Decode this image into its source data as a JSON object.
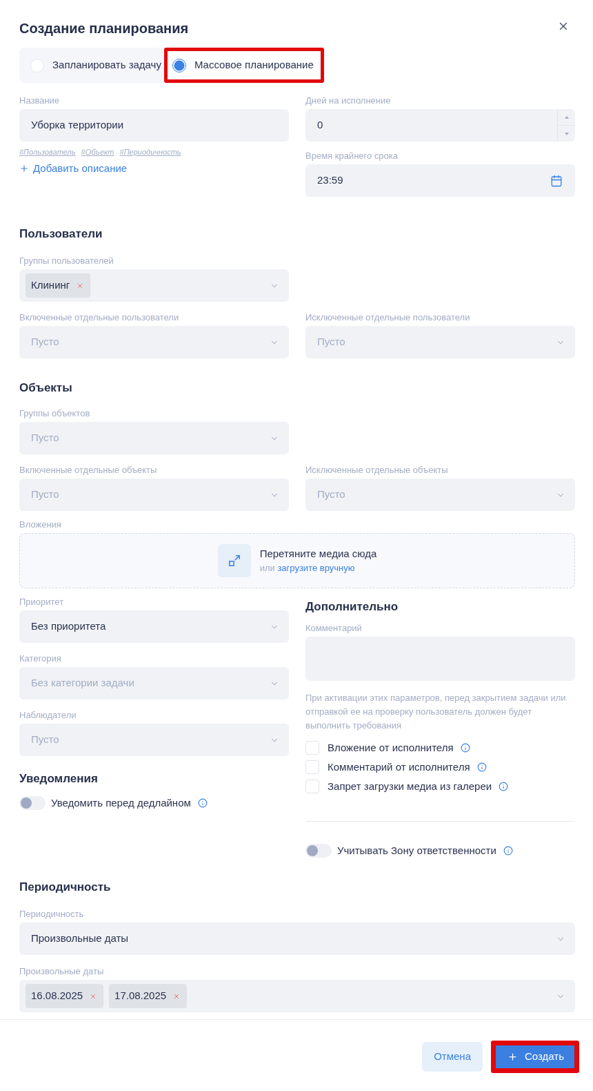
{
  "dialog": {
    "title": "Создание планирования"
  },
  "mode_options": [
    {
      "label": "Запланировать задачу",
      "selected": false,
      "highlighted": false
    },
    {
      "label": "Массовое планирование",
      "selected": true,
      "highlighted": true
    }
  ],
  "general": {
    "name": {
      "label": "Название",
      "value": "Уборка территории"
    },
    "tags": [
      "#Пользователь",
      "#Объект",
      "#Периодичность"
    ],
    "add_description": "Добавить описание",
    "days": {
      "label": "Дней на исполнение",
      "value": "0"
    },
    "deadline_time": {
      "label": "Время крайнего срока",
      "value": "23:59"
    }
  },
  "users": {
    "title": "Пользователи",
    "groups": {
      "label": "Группы пользователей",
      "chips": [
        "Клининг"
      ]
    },
    "included": {
      "label": "Включенные отдельные пользователи",
      "placeholder": "Пусто"
    },
    "excluded": {
      "label": "Исключенные отдельные пользователи",
      "placeholder": "Пусто"
    }
  },
  "objects": {
    "title": "Объекты",
    "groups": {
      "label": "Группы объектов",
      "placeholder": "Пусто"
    },
    "included": {
      "label": "Включенные отдельные объекты",
      "placeholder": "Пусто"
    },
    "excluded": {
      "label": "Исключенные отдельные объекты",
      "placeholder": "Пусто"
    }
  },
  "attachments": {
    "label": "Вложения",
    "title": "Перетяните медиа сюда",
    "hint": "или",
    "link": "загрузите вручную"
  },
  "priority": {
    "label": "Приоритет",
    "value": "Без приоритета"
  },
  "category": {
    "label": "Категория",
    "placeholder": "Без категории задачи"
  },
  "observers": {
    "label": "Наблюдатели",
    "placeholder": "Пусто"
  },
  "notifications": {
    "title": "Уведомления",
    "toggle": {
      "label": "Уведомить перед дедлайном",
      "on": false
    }
  },
  "additional": {
    "title": "Дополнительно",
    "comment": {
      "label": "Комментарий"
    },
    "note": "При активации этих параметров, перед закрытием задачи или отправкой ее на проверку пользователь должен будет выполнить требования",
    "requirements": [
      {
        "label": "Вложение от исполнителя",
        "checked": false
      },
      {
        "label": "Комментарий от исполнителя",
        "checked": false
      },
      {
        "label": "Запрет загрузки медиа из галереи",
        "checked": false
      }
    ],
    "zone_toggle": {
      "label": "Учитывать Зону ответственности",
      "on": false
    }
  },
  "periodicity": {
    "title": "Периодичность",
    "type": {
      "label": "Периодичность",
      "value": "Произвольные даты"
    },
    "dates": {
      "label": "Произвольные даты",
      "chips": [
        "16.08.2025",
        "17.08.2025"
      ]
    }
  },
  "footer": {
    "buttons": [
      {
        "label": "Отмена",
        "kind": "secondary",
        "highlighted": false
      },
      {
        "label": "Создать",
        "kind": "primary",
        "highlighted": true
      }
    ]
  }
}
